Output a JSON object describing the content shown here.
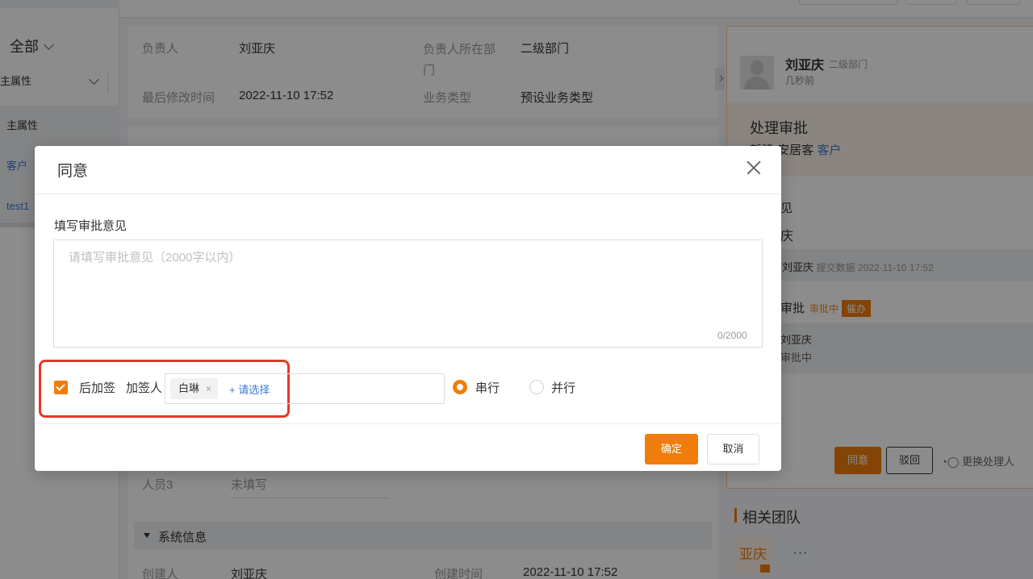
{
  "left_panel": {
    "filter": "全部",
    "attribute_select": "主属性",
    "rows": [
      "主属性",
      "客户",
      "test1"
    ]
  },
  "main": {
    "fields": [
      {
        "label": "负责人",
        "value": "刘亚庆"
      },
      {
        "label": "负责人所在部门",
        "value": "二级部门"
      },
      {
        "label": "最后修改时间",
        "value": "2022-11-10 17:52"
      },
      {
        "label": "业务类型",
        "value": "预设业务类型"
      },
      {
        "label": "人员3",
        "value": "未填写"
      },
      {
        "label": "创建人",
        "value": "刘亚庆"
      },
      {
        "label": "创建时间",
        "value": "2022-11-10 17:52"
      }
    ],
    "system_section": "系统信息"
  },
  "right_panel": {
    "user_name": "刘亚庆",
    "user_dept": "二级部门",
    "user_time": "几秒前",
    "task_title": "处理审批",
    "task_sub_prefix": "新建 安居客",
    "task_sub_link": "客户",
    "opinion_fragment": "见",
    "opinion_name_fragment": "庆",
    "submit_name": "刘亚庆",
    "submit_text": "提交数据 2022-11-10 17:52",
    "approval_fragment": "审批",
    "approval_status": "审批中",
    "urge_label": "催办",
    "approver_fragment": "刘亚庆",
    "approver_status_fragment": "审批中",
    "agree_label": "同意",
    "reject_label": "驳回",
    "change_label": "更换处理人",
    "team_title": "相关团队",
    "team_member": "亚庆",
    "team_more": "···"
  },
  "dialog": {
    "title": "同意",
    "opinion_label": "填写审批意见",
    "opinion_placeholder": "请填写审批意见（2000字以内）",
    "opinion_value": "",
    "counter": "0/2000",
    "post_sign": {
      "checked": true,
      "checkbox_label": "后加签",
      "signer_label": "加签人",
      "tags": [
        "白琳"
      ],
      "tag_remove": "×",
      "pick_label": "+ 请选择"
    },
    "mode": {
      "selected": "串行",
      "options": [
        "串行",
        "并行"
      ]
    },
    "confirm_label": "确定",
    "cancel_label": "取消"
  },
  "colors": {
    "accent": "#f07d0b",
    "link": "#3a79d8",
    "highlight": "#e8362b"
  }
}
